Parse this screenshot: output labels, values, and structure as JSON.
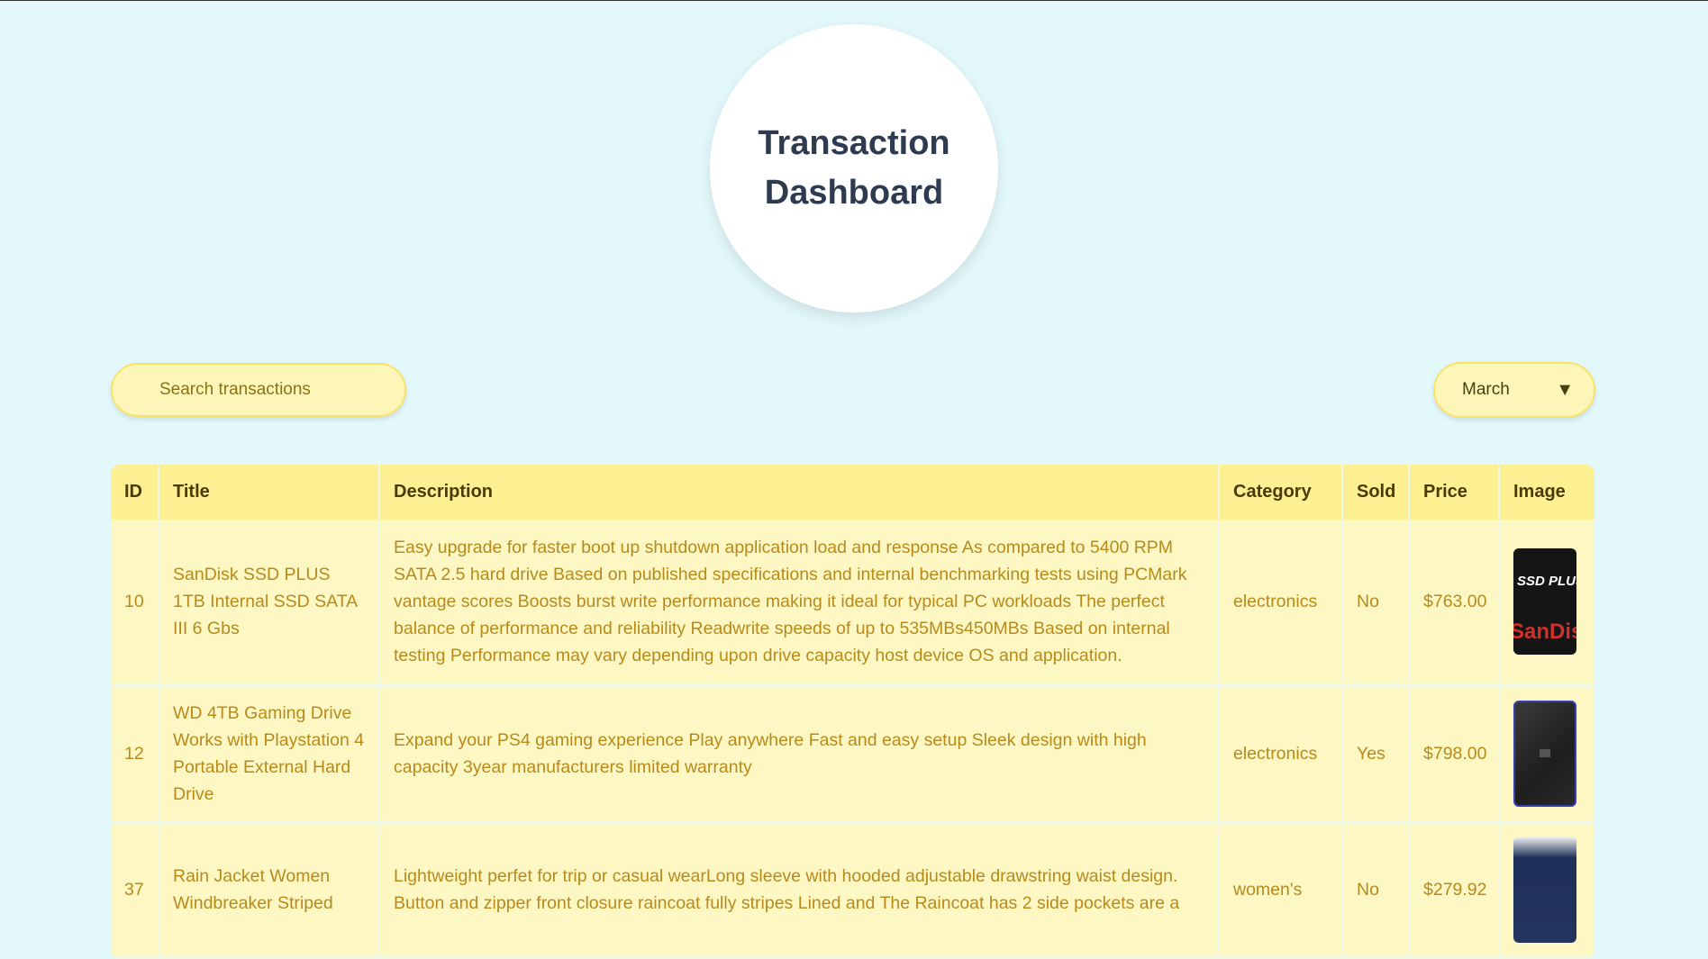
{
  "header": {
    "title": "Transaction Dashboard"
  },
  "search": {
    "placeholder": "Search transactions",
    "value": ""
  },
  "month_select": {
    "selected": "March",
    "arrow": "▼"
  },
  "table": {
    "columns": [
      "ID",
      "Title",
      "Description",
      "Category",
      "Sold",
      "Price",
      "Image"
    ],
    "rows": [
      {
        "id": "10",
        "title": "SanDisk SSD PLUS 1TB Internal SSD SATA III 6 Gbs",
        "description": "Easy upgrade for faster boot up shutdown application load and response As compared to 5400 RPM SATA 2.5 hard drive Based on published specifications and internal benchmarking tests using PCMark vantage scores Boosts burst write performance making it ideal for typical PC workloads The perfect balance of performance and reliability Readwrite speeds of up to 535MBs450MBs Based on internal testing Performance may vary depending upon drive capacity host device OS and application.",
        "category": "electronics",
        "sold": "No",
        "price": "$763.00",
        "image": {
          "icon": "ssd-product-image",
          "text_line1": "SSD PLUS",
          "text_line2": "SanDisk"
        }
      },
      {
        "id": "12",
        "title": "WD 4TB Gaming Drive Works with Playstation 4 Portable External Hard Drive",
        "description": "Expand your PS4 gaming experience Play anywhere Fast and easy setup Sleek design with high capacity 3year manufacturers limited warranty",
        "category": "electronics",
        "sold": "Yes",
        "price": "$798.00",
        "image": {
          "icon": "hard-drive-product-image"
        }
      },
      {
        "id": "37",
        "title": "Rain Jacket Women Windbreaker Striped",
        "description": "Lightweight perfet for trip or casual wearLong sleeve with hooded adjustable drawstring waist design. Button and zipper front closure raincoat fully stripes Lined and The Raincoat has 2 side pockets are a",
        "category": "women's",
        "sold": "No",
        "price": "$279.92",
        "image": {
          "icon": "jacket-product-image"
        }
      }
    ]
  },
  "colors": {
    "background": "#e2f8fa",
    "header_bg": "#fdf093",
    "row_bg": "#fdf7c4",
    "row_text": "#b88a1a",
    "title_text": "#2e3a4f"
  }
}
